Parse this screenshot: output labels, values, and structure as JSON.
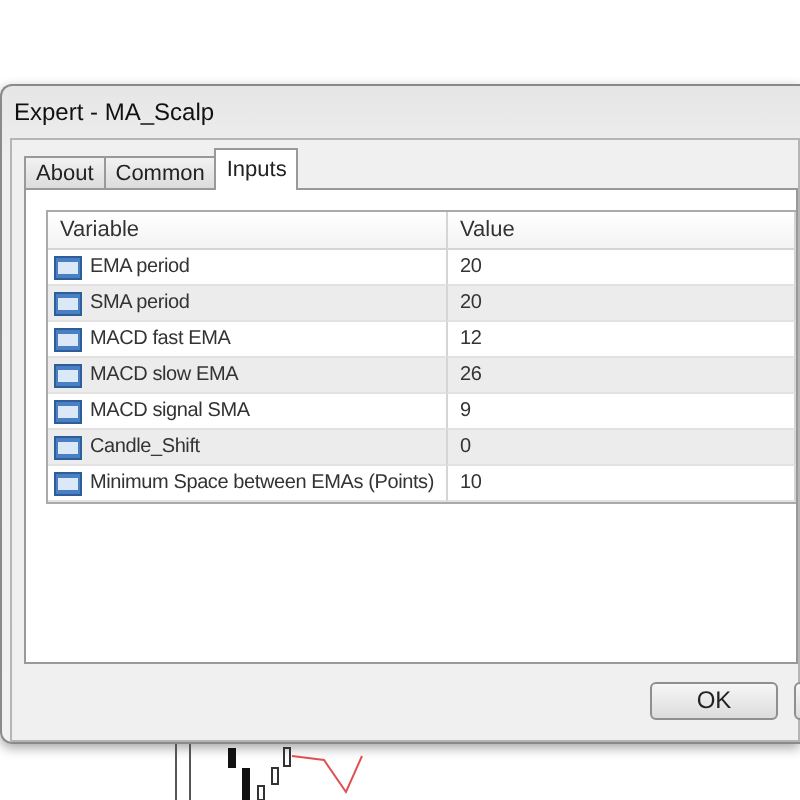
{
  "window": {
    "title": "Expert - MA_Scalp"
  },
  "tabs": [
    {
      "label": "About",
      "selected": false
    },
    {
      "label": "Common",
      "selected": false
    },
    {
      "label": "Inputs",
      "selected": true
    }
  ],
  "table": {
    "columns": [
      "Variable",
      "Value"
    ],
    "rows": [
      {
        "variable": "EMA period",
        "value": "20"
      },
      {
        "variable": "SMA period",
        "value": "20"
      },
      {
        "variable": "MACD fast EMA",
        "value": "12"
      },
      {
        "variable": "MACD slow EMA",
        "value": "26"
      },
      {
        "variable": "MACD signal SMA",
        "value": "9"
      },
      {
        "variable": "Candle_Shift",
        "value": "0"
      },
      {
        "variable": "Minimum Space between EMAs (Points)",
        "value": "10"
      }
    ]
  },
  "buttons": [
    "OK"
  ]
}
